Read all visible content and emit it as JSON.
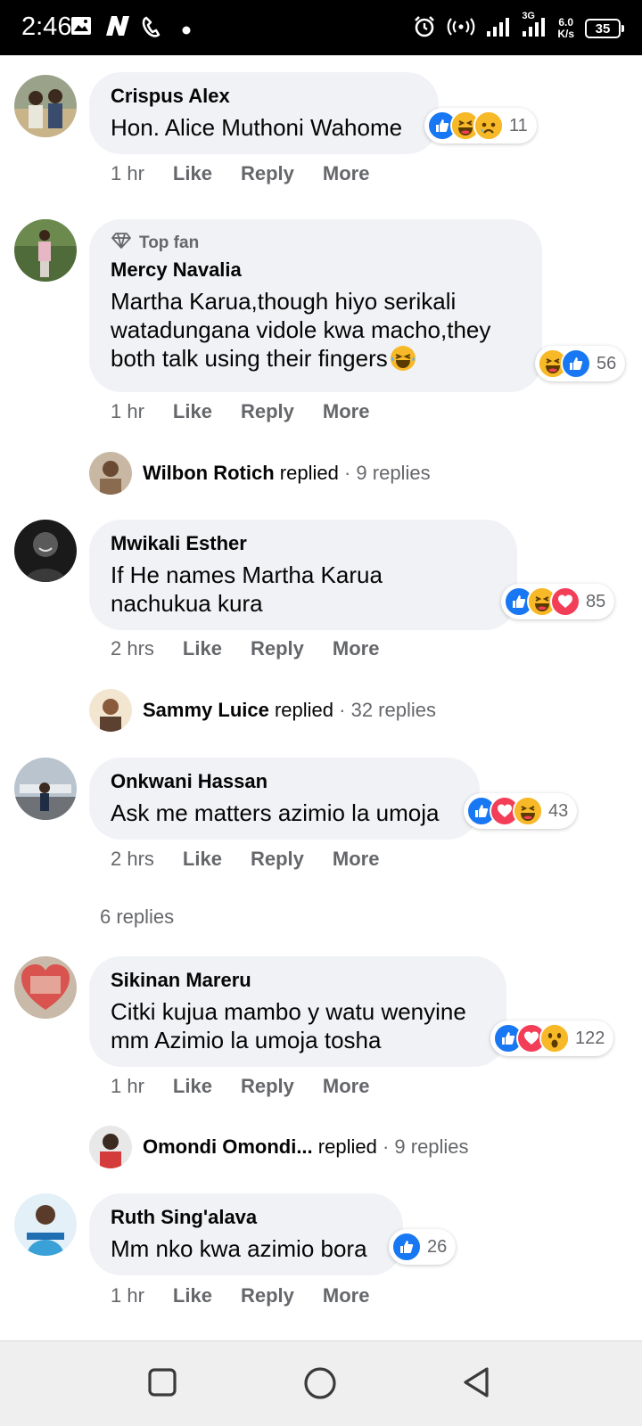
{
  "status_bar": {
    "time": "2:46",
    "network": "3G",
    "speed_value": "6.0",
    "speed_unit": "K/s",
    "battery": "35"
  },
  "comments": [
    {
      "name": "Crispus Alex",
      "text": "Hon. Alice Muthoni Wahome",
      "reactions": [
        "like-icon",
        "haha-icon",
        "sad-icon"
      ],
      "reaction_count": "11",
      "time": "1 hr",
      "like_label": "Like",
      "reply_label": "Reply",
      "more_label": "More"
    },
    {
      "badge": "Top fan",
      "name": "Mercy Navalia",
      "text": "Martha Karua,though hiyo serikali watadungana vidole kwa macho,they both talk using their fingers",
      "reactions": [
        "haha-icon",
        "like-icon"
      ],
      "reaction_count": "56",
      "time": "1 hr",
      "like_label": "Like",
      "reply_label": "Reply",
      "more_label": "More",
      "reply_summary": {
        "name": "Wilbon Rotich",
        "verb": "replied",
        "count": "· 9 replies"
      }
    },
    {
      "name": "Mwikali Esther",
      "text": "If He names Martha Karua nachukua kura",
      "reactions": [
        "like-icon",
        "haha-icon",
        "love-icon"
      ],
      "reaction_count": "85",
      "time": "2 hrs",
      "like_label": "Like",
      "reply_label": "Reply",
      "more_label": "More",
      "reply_summary": {
        "name": "Sammy Luice",
        "verb": "replied",
        "count": "· 32 replies"
      }
    },
    {
      "name": "Onkwani Hassan",
      "text": "Ask me matters azimio la umoja",
      "reactions": [
        "like-icon",
        "love-icon",
        "haha-icon"
      ],
      "reaction_count": "43",
      "time": "2 hrs",
      "like_label": "Like",
      "reply_label": "Reply",
      "more_label": "More",
      "more_replies": "6 replies"
    },
    {
      "name": "Sikinan Mareru",
      "text": "Citki kujua mambo y watu wenyine mm Azimio la umoja tosha",
      "reactions": [
        "like-icon",
        "love-icon",
        "wow-icon"
      ],
      "reaction_count": "122",
      "time": "1 hr",
      "like_label": "Like",
      "reply_label": "Reply",
      "more_label": "More",
      "reply_summary": {
        "name": "Omondi Omondi...",
        "verb": "replied",
        "count": "· 9 replies"
      }
    },
    {
      "name": "Ruth Sing'alava",
      "text": "Mm nko kwa azimio bora",
      "reactions": [
        "like-icon"
      ],
      "reaction_count": "26",
      "time": "1 hr",
      "like_label": "Like",
      "reply_label": "Reply",
      "more_label": "More"
    }
  ],
  "colors": {
    "like_blue": "#1877f2",
    "love_red": "#f33e58",
    "haha_yellow": "#f7b928",
    "bubble_gray": "#f0f2f5",
    "meta_gray": "#65676b"
  }
}
